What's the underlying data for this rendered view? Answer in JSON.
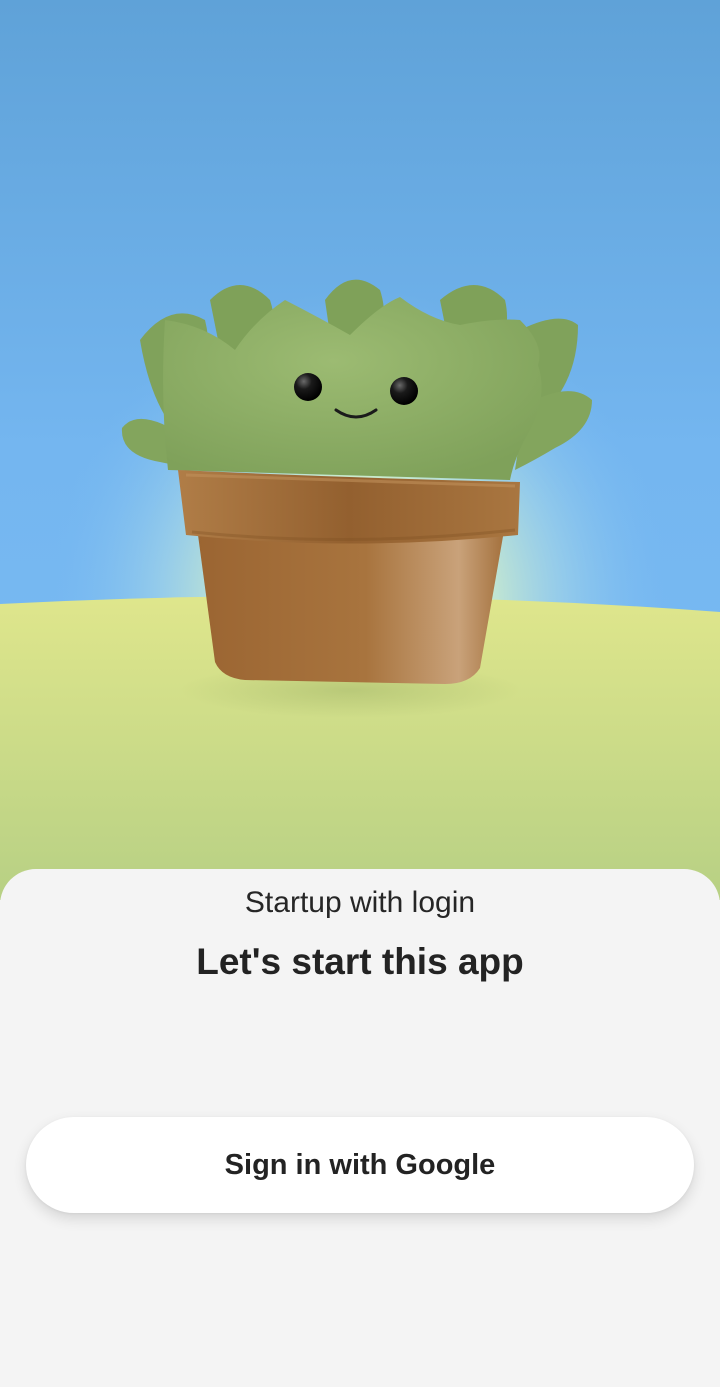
{
  "onboarding": {
    "subtitle": "Startup with login",
    "title": "Let's start this app",
    "google_button_label": "Sign in with Google"
  },
  "illustration": {
    "name": "smiling-cactus-plant",
    "colors": {
      "sky_top": "#5fa2d8",
      "sky_bottom": "#78b8f2",
      "glow": "#dff5c8",
      "hill_top": "#dde58c",
      "hill_bottom": "#b9d284",
      "leaves": "#8fb068",
      "pot": "#a46f3c"
    }
  }
}
